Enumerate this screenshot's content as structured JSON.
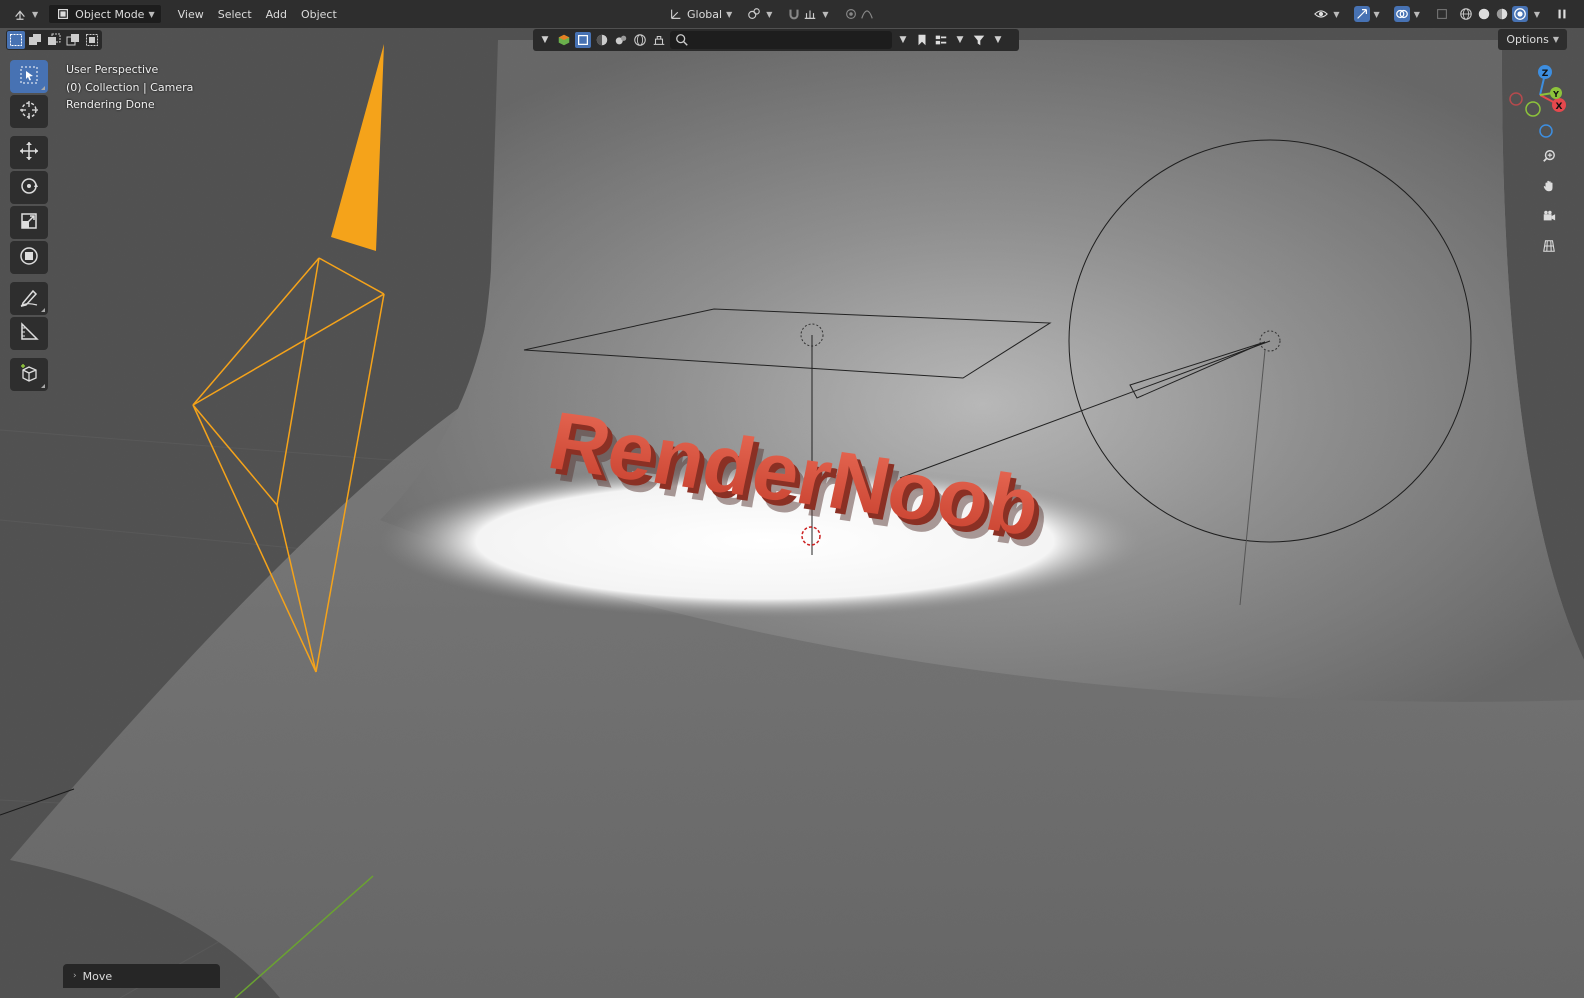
{
  "header": {
    "mode_label": "Object Mode",
    "menus": [
      "View",
      "Select",
      "Add",
      "Object"
    ],
    "transform_orientation": "Global",
    "options_label": "Options"
  },
  "viewport": {
    "overlay_lines": [
      "User Perspective",
      "(0) Collection | Camera",
      "Rendering Done"
    ],
    "scene_text": "RenderNoob",
    "gizmo_axes": {
      "x": "X",
      "y": "Y",
      "z": "Z"
    }
  },
  "operator_panel": {
    "label": "Move"
  },
  "colors": {
    "accent": "#4772b3",
    "camera_selected": "#f5a31a",
    "text_3d": "#e0553f",
    "axis_x": "#e5484d",
    "axis_y": "#8dc33b",
    "axis_z": "#3d8ee0"
  },
  "icons": {
    "tools": [
      "select-box-icon",
      "cursor-icon",
      "move-icon",
      "rotate-icon",
      "scale-icon",
      "transform-icon",
      "annotate-icon",
      "measure-icon",
      "add-cube-icon"
    ],
    "nav": [
      "zoom-icon",
      "hand-pan-icon",
      "camera-view-icon",
      "grid-ortho-icon"
    ]
  }
}
